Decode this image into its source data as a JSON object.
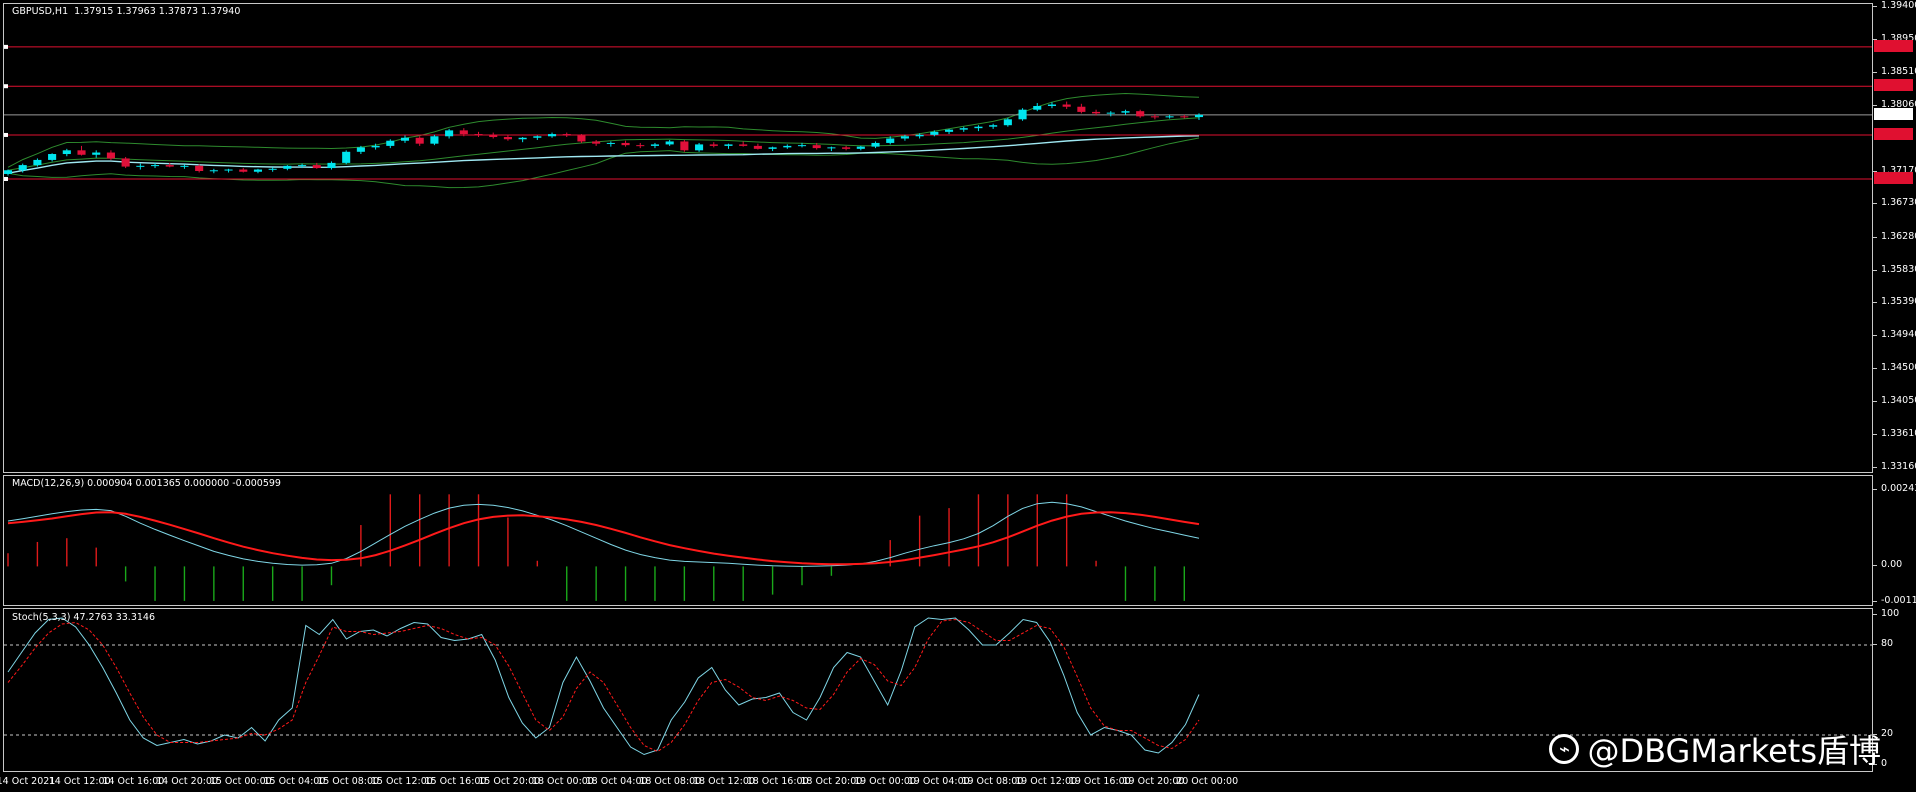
{
  "header": {
    "symbol": "GBPUSD,H1",
    "ohlc": "1.37915 1.37963 1.37873 1.37940"
  },
  "price_axis": {
    "labels": [
      "1.39400",
      "1.38950",
      "1.38510",
      "1.38060",
      "1.37170",
      "1.36730",
      "1.36280",
      "1.35830",
      "1.35390",
      "1.34940",
      "1.34500",
      "1.34050",
      "1.33610",
      "1.33160"
    ],
    "current_price": "1.37940",
    "hlines": [
      {
        "tag": "1.38860",
        "value": 1.3886
      },
      {
        "tag": "1.38328",
        "value": 1.38328
      },
      {
        "tag": "1.37668",
        "value": 1.37668
      },
      {
        "tag": "1.37072",
        "value": 1.37072
      }
    ]
  },
  "macd": {
    "label": "MACD(12,26,9) 0.000904 0.001365 0.000000 -0.000599",
    "axis": [
      "0.002438",
      "0.00",
      "-0.001136"
    ]
  },
  "stoch": {
    "label": "Stoch(5,3,3) 47.2763 33.3146",
    "axis": [
      "100",
      "80",
      "20",
      "0"
    ]
  },
  "time_axis": {
    "labels": [
      "14 Oct 2021",
      "14 Oct 12:00",
      "14 Oct 16:00",
      "14 Oct 20:00",
      "15 Oct 00:00",
      "15 Oct 04:00",
      "15 Oct 08:00",
      "15 Oct 12:00",
      "15 Oct 16:00",
      "15 Oct 20:00",
      "18 Oct 00:00",
      "18 Oct 04:00",
      "18 Oct 08:00",
      "18 Oct 12:00",
      "18 Oct 16:00",
      "18 Oct 20:00",
      "19 Oct 00:00",
      "19 Oct 04:00",
      "19 Oct 08:00",
      "19 Oct 12:00",
      "19 Oct 16:00",
      "19 Oct 20:00",
      "20 Oct 00:00"
    ]
  },
  "watermark": {
    "icon": "weibo-icon",
    "text": "@DBGMarkets盾博"
  },
  "colors": {
    "bull": "#00e5ee",
    "bear": "#e0103a",
    "signal": "#ff1a1a",
    "macd_line": "#7fd6e6",
    "hist_pos": "#e01a1a",
    "hist_neg": "#1aa81a",
    "bands": "#2e8b2e",
    "ma": "#9fe8f2"
  },
  "chart_data": [
    {
      "type": "candlestick",
      "title": "GBPUSD,H1",
      "ylim": [
        1.3316,
        1.394
      ],
      "candles": [
        [
          1.3714,
          1.372,
          1.3712,
          1.3719
        ],
        [
          1.3719,
          1.3728,
          1.3716,
          1.3726
        ],
        [
          1.3726,
          1.3735,
          1.3724,
          1.3733
        ],
        [
          1.3733,
          1.3742,
          1.3731,
          1.3741
        ],
        [
          1.3741,
          1.3748,
          1.3738,
          1.3746
        ],
        [
          1.3746,
          1.3752,
          1.3739,
          1.374
        ],
        [
          1.374,
          1.3746,
          1.3736,
          1.3743
        ],
        [
          1.3743,
          1.3746,
          1.3733,
          1.3735
        ],
        [
          1.3735,
          1.3737,
          1.3722,
          1.3724
        ],
        [
          1.3724,
          1.3728,
          1.372,
          1.3725
        ],
        [
          1.3725,
          1.3729,
          1.3722,
          1.3726
        ],
        [
          1.3726,
          1.3729,
          1.3723,
          1.3724
        ],
        [
          1.3724,
          1.3727,
          1.3721,
          1.3725
        ],
        [
          1.3725,
          1.3727,
          1.3716,
          1.3718
        ],
        [
          1.3718,
          1.3721,
          1.3715,
          1.3719
        ],
        [
          1.3719,
          1.3721,
          1.3716,
          1.372
        ],
        [
          1.372,
          1.3722,
          1.3716,
          1.3717
        ],
        [
          1.3717,
          1.3721,
          1.3715,
          1.372
        ],
        [
          1.372,
          1.3723,
          1.3717,
          1.3721
        ],
        [
          1.3721,
          1.3726,
          1.3719,
          1.3725
        ],
        [
          1.3725,
          1.3728,
          1.3722,
          1.3726
        ],
        [
          1.3726,
          1.3729,
          1.3721,
          1.3722
        ],
        [
          1.3722,
          1.3731,
          1.372,
          1.3729
        ],
        [
          1.3729,
          1.3746,
          1.3727,
          1.3744
        ],
        [
          1.3744,
          1.3752,
          1.3741,
          1.375
        ],
        [
          1.375,
          1.3755,
          1.3747,
          1.3752
        ],
        [
          1.3752,
          1.3761,
          1.3749,
          1.3759
        ],
        [
          1.3759,
          1.3766,
          1.3756,
          1.3763
        ],
        [
          1.3763,
          1.3765,
          1.3752,
          1.3755
        ],
        [
          1.3755,
          1.3767,
          1.3753,
          1.3765
        ],
        [
          1.3765,
          1.3775,
          1.3762,
          1.3773
        ],
        [
          1.3773,
          1.3776,
          1.3765,
          1.3768
        ],
        [
          1.3768,
          1.3771,
          1.3764,
          1.3767
        ],
        [
          1.3767,
          1.377,
          1.3762,
          1.3764
        ],
        [
          1.3764,
          1.3767,
          1.3759,
          1.3761
        ],
        [
          1.3761,
          1.3764,
          1.3757,
          1.3763
        ],
        [
          1.3763,
          1.3766,
          1.376,
          1.3765
        ],
        [
          1.3765,
          1.377,
          1.3763,
          1.3768
        ],
        [
          1.3768,
          1.377,
          1.3764,
          1.3766
        ],
        [
          1.3766,
          1.3768,
          1.3756,
          1.3758
        ],
        [
          1.3758,
          1.376,
          1.3752,
          1.3755
        ],
        [
          1.3755,
          1.3758,
          1.3751,
          1.3756
        ],
        [
          1.3756,
          1.3759,
          1.3751,
          1.3753
        ],
        [
          1.3753,
          1.3756,
          1.3749,
          1.3752
        ],
        [
          1.3752,
          1.3756,
          1.3749,
          1.3754
        ],
        [
          1.3754,
          1.376,
          1.3752,
          1.3758
        ],
        [
          1.3758,
          1.376,
          1.3744,
          1.3746
        ],
        [
          1.3746,
          1.3756,
          1.3744,
          1.3754
        ],
        [
          1.3754,
          1.3757,
          1.375,
          1.3752
        ],
        [
          1.3752,
          1.3755,
          1.3748,
          1.3754
        ],
        [
          1.3754,
          1.3758,
          1.3751,
          1.3752
        ],
        [
          1.3752,
          1.3755,
          1.3747,
          1.3748
        ],
        [
          1.3748,
          1.3751,
          1.3745,
          1.375
        ],
        [
          1.375,
          1.3754,
          1.3748,
          1.3752
        ],
        [
          1.3752,
          1.3756,
          1.375,
          1.3753
        ],
        [
          1.3753,
          1.3756,
          1.3747,
          1.3749
        ],
        [
          1.3749,
          1.3751,
          1.3745,
          1.375
        ],
        [
          1.375,
          1.3752,
          1.3746,
          1.3748
        ],
        [
          1.3748,
          1.3752,
          1.3746,
          1.3751
        ],
        [
          1.3751,
          1.3758,
          1.3749,
          1.3756
        ],
        [
          1.3756,
          1.3765,
          1.3754,
          1.3762
        ],
        [
          1.3762,
          1.3767,
          1.3759,
          1.3765
        ],
        [
          1.3765,
          1.3769,
          1.3762,
          1.3767
        ],
        [
          1.3767,
          1.3773,
          1.3765,
          1.3771
        ],
        [
          1.3771,
          1.3775,
          1.3768,
          1.3774
        ],
        [
          1.3774,
          1.3778,
          1.3771,
          1.3776
        ],
        [
          1.3776,
          1.378,
          1.3772,
          1.3778
        ],
        [
          1.3778,
          1.3782,
          1.3775,
          1.378
        ],
        [
          1.378,
          1.379,
          1.3778,
          1.3788
        ],
        [
          1.3788,
          1.3803,
          1.3786,
          1.3801
        ],
        [
          1.3801,
          1.381,
          1.3799,
          1.3806
        ],
        [
          1.3806,
          1.3811,
          1.3803,
          1.3808
        ],
        [
          1.3808,
          1.3812,
          1.3802,
          1.3805
        ],
        [
          1.3805,
          1.3809,
          1.3796,
          1.3798
        ],
        [
          1.3798,
          1.3801,
          1.3793,
          1.3796
        ],
        [
          1.3796,
          1.3799,
          1.3792,
          1.3797
        ],
        [
          1.3797,
          1.3801,
          1.3794,
          1.3799
        ],
        [
          1.3799,
          1.3801,
          1.379,
          1.3792
        ],
        [
          1.3792,
          1.3795,
          1.3788,
          1.3791
        ],
        [
          1.3791,
          1.3794,
          1.3789,
          1.3792
        ],
        [
          1.3792,
          1.3794,
          1.3789,
          1.3791
        ],
        [
          1.3791,
          1.3796,
          1.3787,
          1.3794
        ]
      ]
    },
    {
      "type": "line",
      "title": "MACD(12,26,9) 0.000904 0.001365 0.000000 -0.000599",
      "ylim": [
        -0.001136,
        0.002438
      ],
      "series": [
        {
          "values": [
            0.00145,
            0.00152,
            0.0016,
            0.00168,
            0.00175,
            0.0018,
            0.00182,
            0.00178,
            0.0016,
            0.00138,
            0.00118,
            0.001,
            0.00082,
            0.00065,
            0.00048,
            0.00035,
            0.00024,
            0.00016,
            0.0001,
            6e-05,
            4e-05,
            5e-05,
            0.0001,
            0.00025,
            0.00048,
            0.00075,
            0.00102,
            0.00128,
            0.0015,
            0.0017,
            0.00186,
            0.00195,
            0.00198,
            0.00195,
            0.00188,
            0.00177,
            0.00163,
            0.00148,
            0.0013,
            0.0011,
            0.0009,
            0.0007,
            0.00052,
            0.00038,
            0.00028,
            0.0002,
            0.00016,
            0.00014,
            0.00012,
            0.0001,
            7e-05,
            4e-05,
            2e-05,
            1e-05,
            0.0,
            1e-05,
            2e-05,
            4e-05,
            8e-05,
            0.00016,
            0.00028,
            0.00042,
            0.00055,
            0.00066,
            0.00076,
            0.00088,
            0.00105,
            0.0013,
            0.0016,
            0.00185,
            0.002,
            0.00205,
            0.002,
            0.0019,
            0.00175,
            0.0016,
            0.00145,
            0.00132,
            0.0012,
            0.0011,
            0.001,
            0.0009
          ]
        },
        {
          "values": [
            0.00138,
            0.00142,
            0.00147,
            0.00153,
            0.0016,
            0.00167,
            0.00172,
            0.00173,
            0.00168,
            0.00158,
            0.00146,
            0.00133,
            0.00119,
            0.00105,
            0.0009,
            0.00076,
            0.00063,
            0.00052,
            0.00042,
            0.00034,
            0.00027,
            0.00022,
            0.0002,
            0.00021,
            0.00026,
            0.00036,
            0.0005,
            0.00067,
            0.00085,
            0.00104,
            0.00122,
            0.00138,
            0.0015,
            0.00158,
            0.00162,
            0.00163,
            0.0016,
            0.00156,
            0.0015,
            0.00142,
            0.00132,
            0.0012,
            0.00107,
            0.00093,
            0.0008,
            0.00068,
            0.00058,
            0.00049,
            0.00041,
            0.00034,
            0.00028,
            0.00022,
            0.00017,
            0.00013,
            0.0001,
            8e-05,
            7e-05,
            7e-05,
            8e-05,
            0.0001,
            0.00014,
            0.0002,
            0.00028,
            0.00036,
            0.00045,
            0.00054,
            0.00064,
            0.00077,
            0.00093,
            0.00111,
            0.0013,
            0.00146,
            0.00159,
            0.00168,
            0.00172,
            0.00173,
            0.0017,
            0.00165,
            0.00158,
            0.0015,
            0.00142,
            0.00135
          ]
        }
      ]
    },
    {
      "type": "line",
      "title": "Stoch(5,3,3) 47.2763 33.3146",
      "ylim": [
        0,
        100
      ],
      "series": [
        {
          "values": [
            62,
            75,
            88,
            97,
            98,
            92,
            80,
            65,
            48,
            30,
            18,
            13,
            15,
            17,
            14,
            16,
            20,
            18,
            25,
            16,
            30,
            38,
            93,
            87,
            97,
            84,
            89,
            90,
            86,
            91,
            95,
            94,
            85,
            83,
            84,
            87,
            70,
            45,
            28,
            18,
            25,
            55,
            72,
            56,
            38,
            25,
            12,
            7,
            10,
            30,
            42,
            58,
            65,
            50,
            40,
            44,
            45,
            48,
            35,
            30,
            45,
            65,
            75,
            72,
            56,
            40,
            63,
            92,
            98,
            97,
            98,
            90,
            80,
            80,
            88,
            97,
            95,
            82,
            60,
            35,
            20,
            25,
            23,
            20,
            10,
            8,
            15,
            27,
            47
          ]
        },
        {
          "values": [
            55,
            66,
            78,
            88,
            94,
            95,
            90,
            80,
            65,
            48,
            32,
            20,
            15,
            15,
            15,
            16,
            17,
            18,
            21,
            20,
            24,
            30,
            55,
            73,
            92,
            89,
            89,
            87,
            88,
            89,
            91,
            93,
            91,
            87,
            84,
            85,
            80,
            66,
            48,
            30,
            23,
            32,
            51,
            62,
            55,
            40,
            25,
            13,
            9,
            15,
            27,
            43,
            55,
            57,
            52,
            45,
            43,
            46,
            43,
            38,
            37,
            47,
            62,
            71,
            67,
            56,
            53,
            65,
            84,
            96,
            97,
            95,
            89,
            83,
            83,
            88,
            93,
            91,
            79,
            59,
            38,
            26,
            23,
            23,
            18,
            13,
            11,
            17,
            30
          ]
        }
      ]
    }
  ]
}
